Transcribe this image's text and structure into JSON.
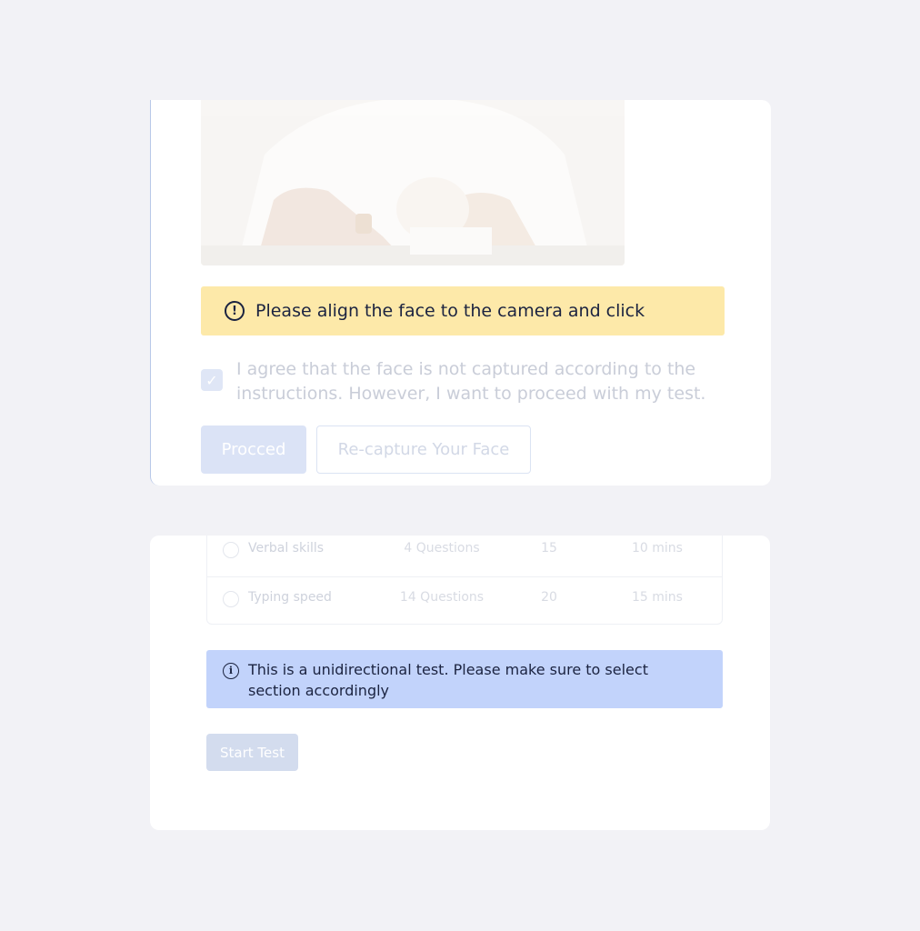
{
  "face_capture": {
    "warning_text": "Please align the face to the camera and click",
    "agree_checked": true,
    "agree_text": "I agree that the face is not captured according to the instructions. However, I want to proceed with my test.",
    "proceed_label": "Procced",
    "recapture_label": "Re-capture Your Face",
    "warning_icon": "alert-circle-icon"
  },
  "sections": {
    "rows": [
      {
        "name": "Verbal skills",
        "questions": "4 Questions",
        "marks": "15",
        "time": "10 mins"
      },
      {
        "name": "Typing speed",
        "questions": "14 Questions",
        "marks": "20",
        "time": "15 mins"
      }
    ],
    "info_text": "This is a unidirectional test. Please make sure to select section accordingly",
    "info_icon": "info-circle-icon",
    "start_label": "Start Test"
  },
  "colors": {
    "background": "#f2f2f6",
    "warning_bg": "#fde9a9",
    "info_bg": "#c2d3fb",
    "text_dark": "#1b2340"
  }
}
